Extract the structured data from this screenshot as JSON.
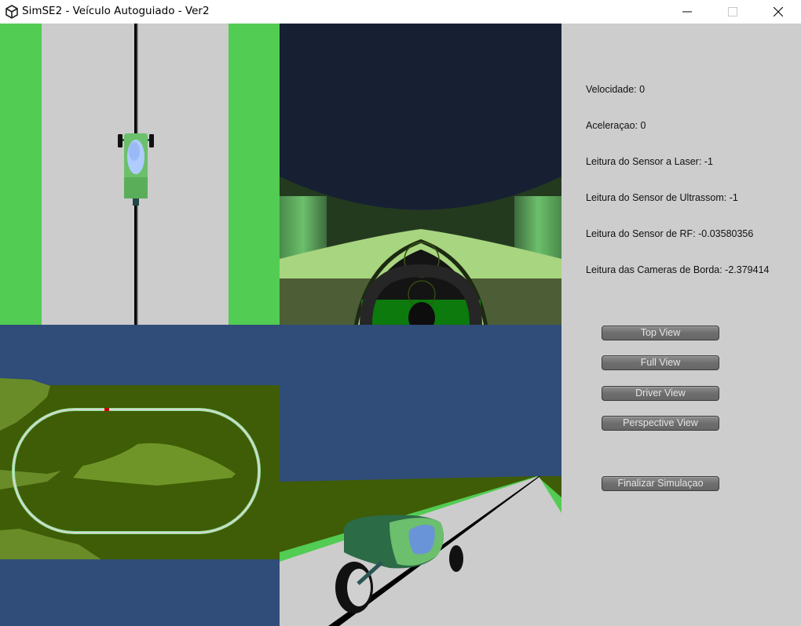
{
  "window": {
    "title": "SimSE2 - Veículo Autoguiado - Ver2",
    "app_icon": "unity-logo-icon",
    "controls": [
      "minimize-icon",
      "maximize-icon",
      "close-icon"
    ]
  },
  "viewports": {
    "top": {
      "name": "Top View camera",
      "scene": "car on track seen from above"
    },
    "driver": {
      "name": "Driver View camera",
      "scene": "cockpit with steering wheel"
    },
    "full": {
      "name": "Full View camera",
      "scene": "oval track overview with red car marker"
    },
    "perspective": {
      "name": "Perspective View camera",
      "scene": "3-wheel vehicle on road"
    }
  },
  "colors": {
    "grass": "#52cc52",
    "road": "#cccccc",
    "sky_driver": "#172033",
    "sky": "#304c78",
    "terrain": "#3f5c06",
    "hill": "#6a8c28",
    "car_body": "#6cc06c",
    "canopy": "#6a94d8",
    "car_marker": "#cc0000",
    "panel_bg": "#cdcdcd",
    "button_bg": "#757575"
  },
  "readouts": [
    {
      "label": "Velocidade:",
      "value": "0"
    },
    {
      "label": "Aceleraçao:",
      "value": "0"
    },
    {
      "label": "Leitura do Sensor a Laser:",
      "value": "-1"
    },
    {
      "label": "Leitura do Sensor de Ultrassom:",
      "value": "-1"
    },
    {
      "label": "Leitura do Sensor de RF:",
      "value": "-0.03580356"
    },
    {
      "label": "Leitura das Cameras de Borda:",
      "value": "-2.379414"
    }
  ],
  "readout_text": [
    "Velocidade: 0",
    "Aceleraçao: 0",
    "Leitura do Sensor a Laser: -1",
    "Leitura do Sensor de Ultrassom: -1",
    "Leitura do Sensor de RF: -0.03580356",
    "Leitura das Cameras de Borda: -2.379414"
  ],
  "buttons": {
    "top_view": "Top View",
    "full_view": "Full View",
    "driver_view": "Driver View",
    "perspective_view": "Perspective View",
    "finish": "Finalizar Simulaçao"
  }
}
